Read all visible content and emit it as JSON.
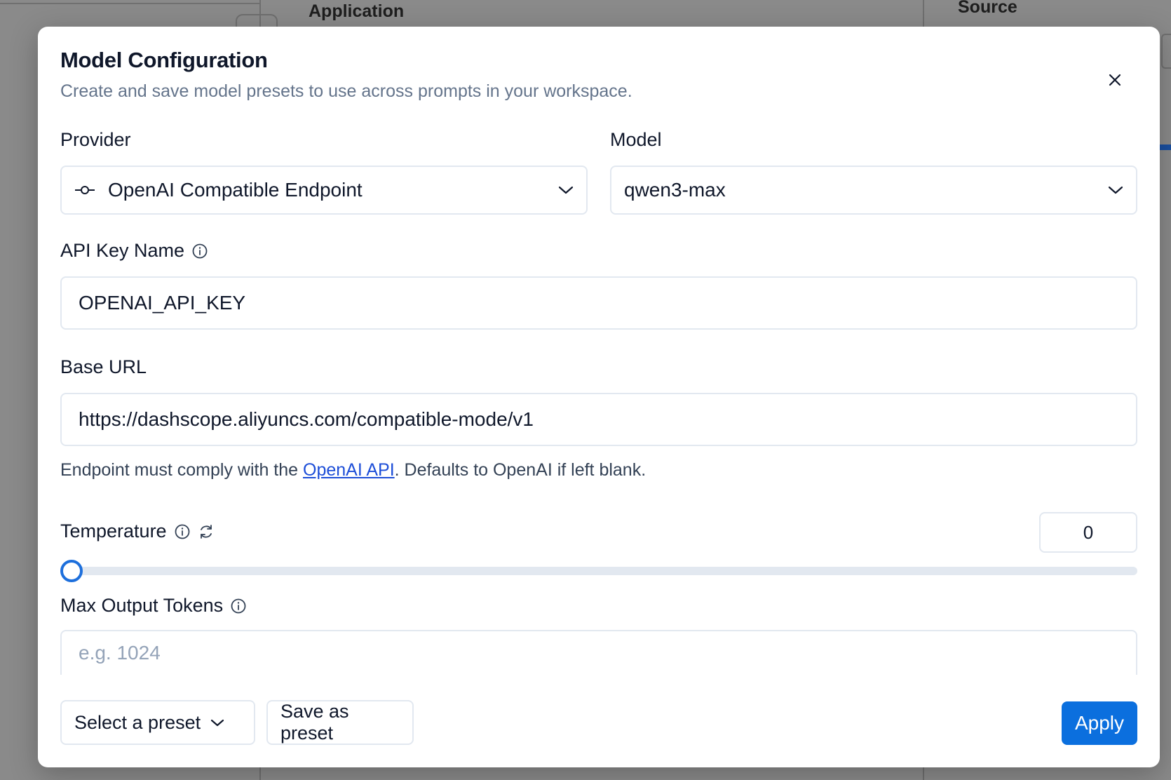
{
  "background": {
    "column_headers": [
      "Application",
      "Source"
    ]
  },
  "modal": {
    "title": "Model Configuration",
    "subtitle": "Create and save model presets to use across prompts in your workspace.",
    "provider": {
      "label": "Provider",
      "value": "OpenAI Compatible Endpoint",
      "icon": "endpoint-icon"
    },
    "model": {
      "label": "Model",
      "value": "qwen3-max"
    },
    "api_key_name": {
      "label": "API Key Name",
      "value": "OPENAI_API_KEY"
    },
    "base_url": {
      "label": "Base URL",
      "value": "https://dashscope.aliyuncs.com/compatible-mode/v1",
      "help_prefix": "Endpoint must comply with the ",
      "help_link": "OpenAI API",
      "help_suffix": ". Defaults to OpenAI if left blank."
    },
    "temperature": {
      "label": "Temperature",
      "value": "0",
      "slider_fraction": 0
    },
    "max_output_tokens": {
      "label": "Max Output Tokens",
      "placeholder": "e.g. 1024"
    },
    "footer": {
      "preset_select": "Select a preset",
      "save_preset": "Save as preset",
      "apply": "Apply"
    }
  },
  "colors": {
    "accent": "#0b6fde",
    "border": "#e2e8f0",
    "muted_text": "#64748b",
    "overlay": "#8a8a8a"
  }
}
